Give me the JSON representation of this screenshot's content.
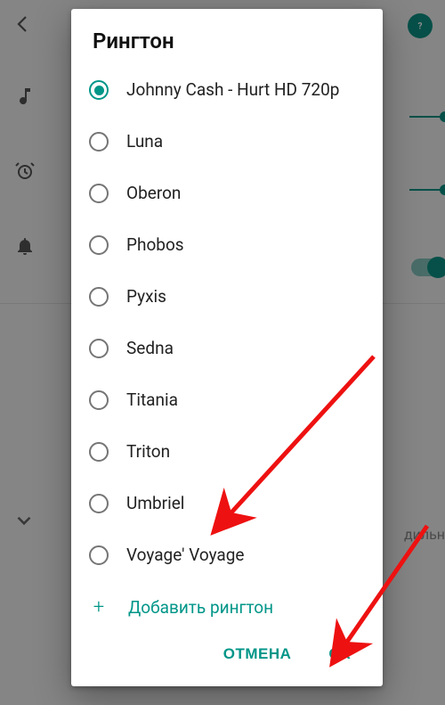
{
  "dialog": {
    "title": "Рингтон",
    "options": [
      {
        "label": "Johnny Cash - Hurt HD 720p",
        "selected": true
      },
      {
        "label": "Luna",
        "selected": false
      },
      {
        "label": "Oberon",
        "selected": false
      },
      {
        "label": "Phobos",
        "selected": false
      },
      {
        "label": "Pyxis",
        "selected": false
      },
      {
        "label": "Sedna",
        "selected": false
      },
      {
        "label": "Titania",
        "selected": false
      },
      {
        "label": "Triton",
        "selected": false
      },
      {
        "label": "Umbriel",
        "selected": false
      },
      {
        "label": "Voyage' Voyage",
        "selected": false
      }
    ],
    "add_label": "Добавить рингтон",
    "cancel_label": "ОТМЕНА",
    "ok_label": "ОК"
  },
  "background": {
    "partial_text": "дильн"
  }
}
